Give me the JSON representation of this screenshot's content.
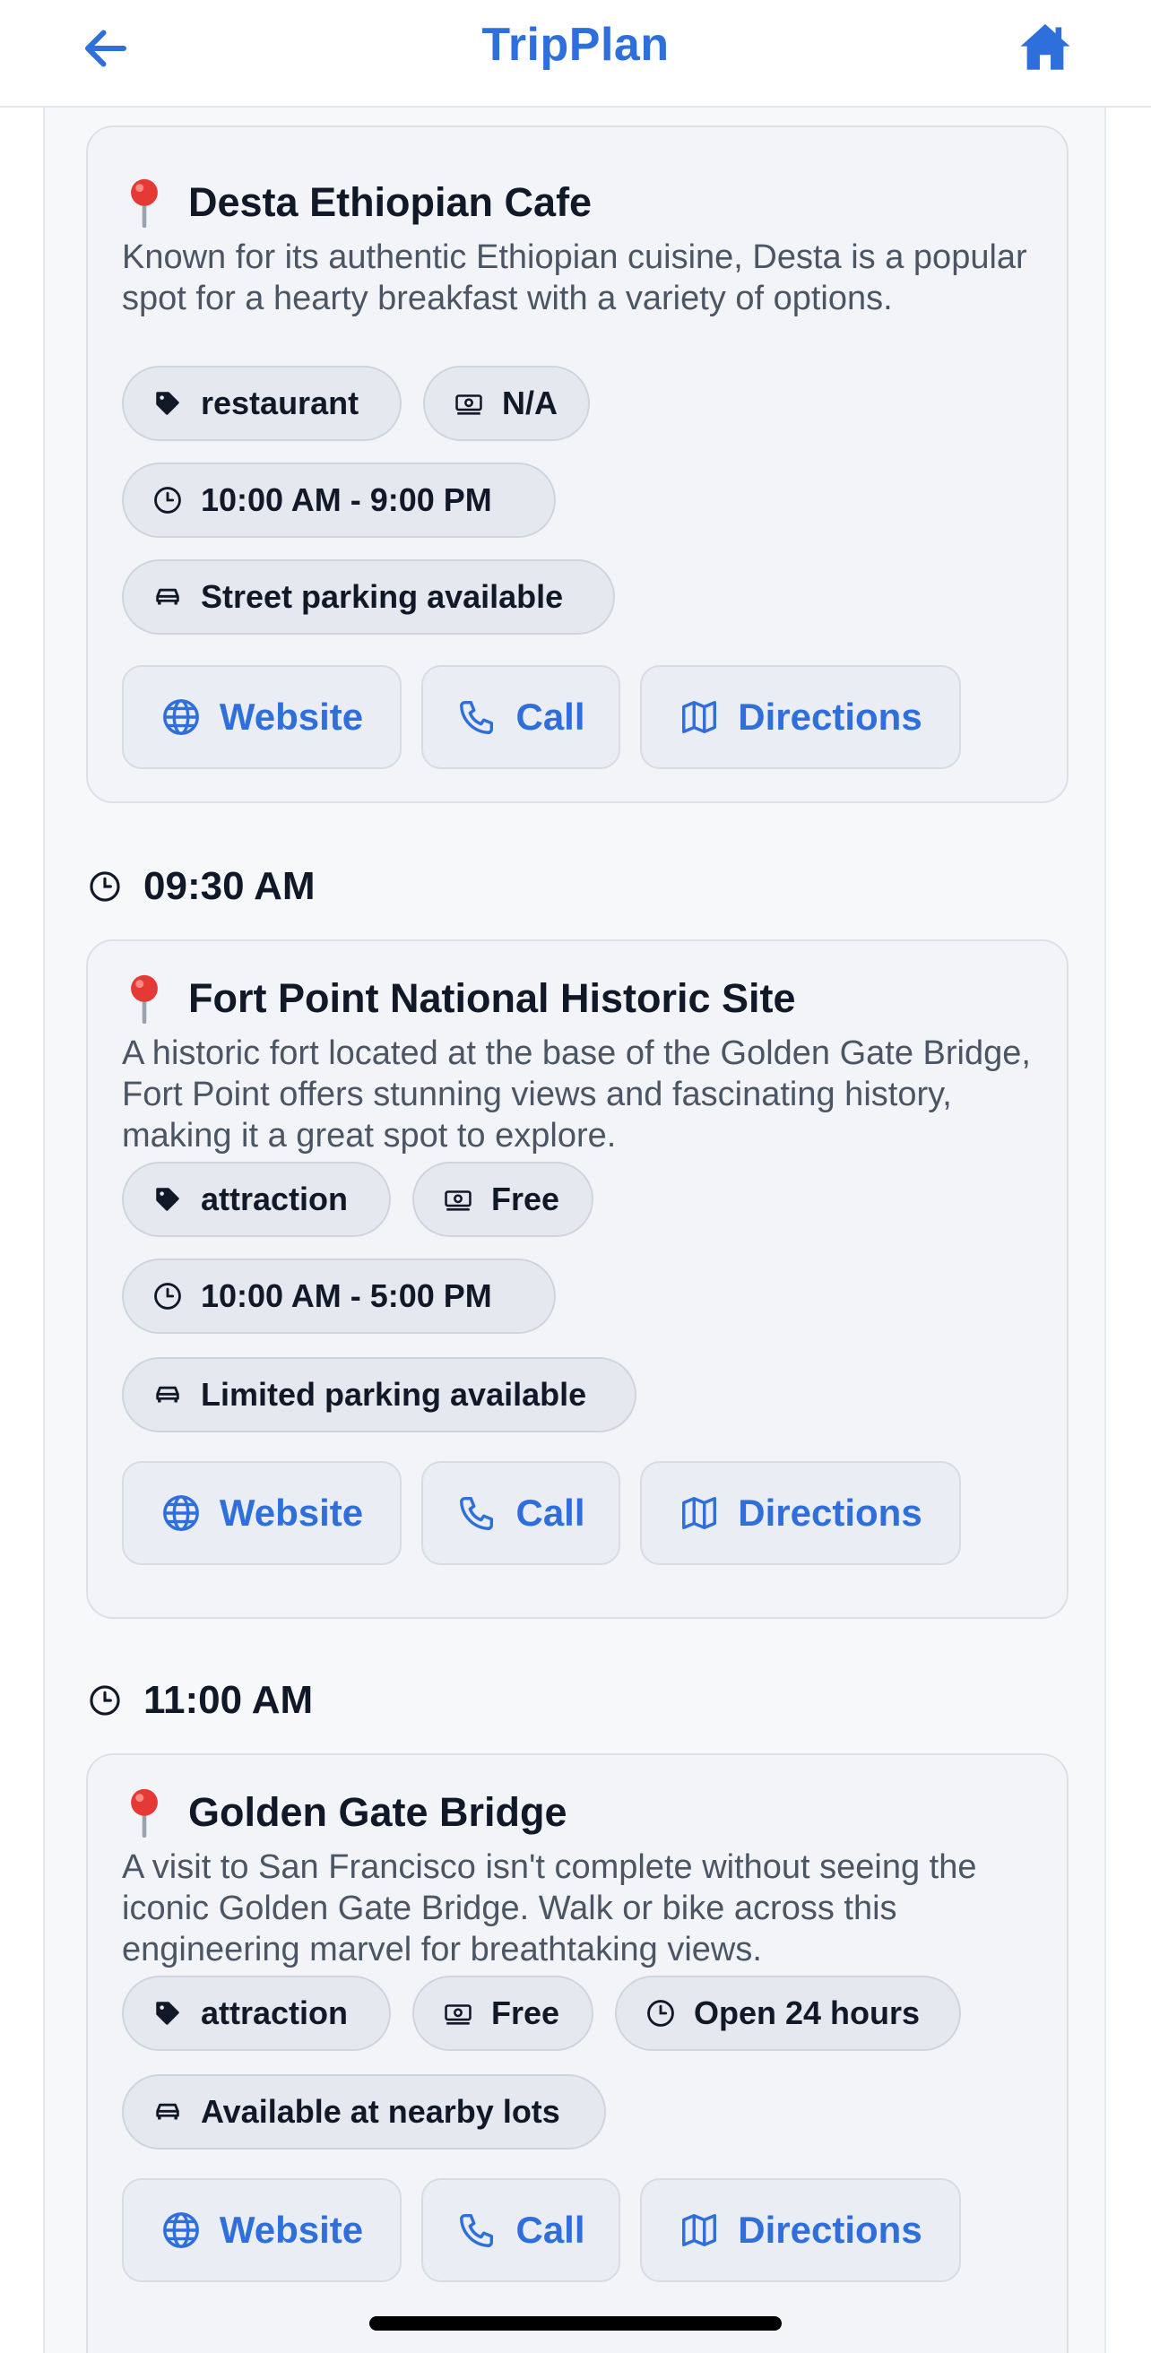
{
  "header": {
    "title": "TripPlan",
    "back_icon": "arrow-left-icon",
    "home_icon": "home-icon"
  },
  "colors": {
    "accent": "#2f6fdb",
    "text": "#111827",
    "muted": "#4b5563",
    "chip_bg": "#e5e9ef",
    "card_bg": "#f2f4f8"
  },
  "items": [
    {
      "time": "",
      "name": "Desta Ethiopian Cafe",
      "description": "Known for its authentic Ethiopian cuisine, Desta is a popular spot for a hearty breakfast with a variety of options.",
      "category": "restaurant",
      "price": "N/A",
      "hours": "10:00 AM - 9:00 PM",
      "parking": "Street parking available",
      "buttons": {
        "website": "Website",
        "call": "Call",
        "directions": "Directions"
      }
    },
    {
      "time": "09:30 AM",
      "name": "Fort Point National Historic Site",
      "description": "A historic fort located at the base of the Golden Gate Bridge, Fort Point offers stunning views and fascinating history, making it a great spot to explore.",
      "category": "attraction",
      "price": "Free",
      "hours": "10:00 AM - 5:00 PM",
      "parking": "Limited parking available",
      "buttons": {
        "website": "Website",
        "call": "Call",
        "directions": "Directions"
      }
    },
    {
      "time": "11:00 AM",
      "name": "Golden Gate Bridge",
      "description": "A visit to San Francisco isn't complete without seeing the iconic Golden Gate Bridge. Walk or bike across this engineering marvel for breathtaking views.",
      "category": "attraction",
      "price": "Free",
      "hours": "Open 24 hours",
      "parking": "Available at nearby lots",
      "buttons": {
        "website": "Website",
        "call": "Call",
        "directions": "Directions"
      }
    }
  ]
}
